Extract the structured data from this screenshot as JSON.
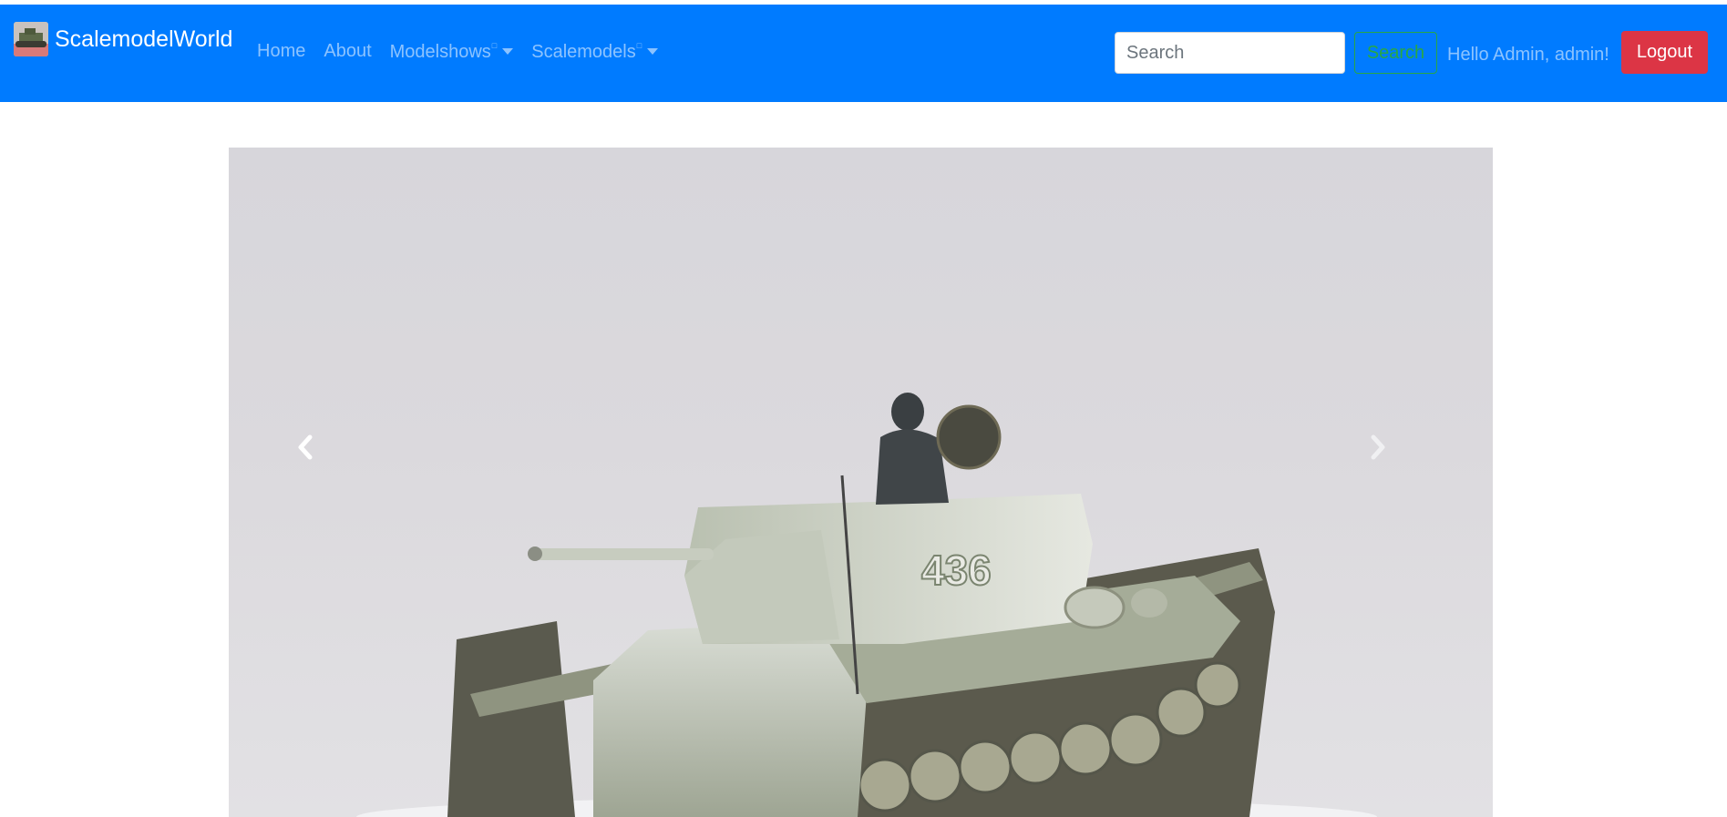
{
  "navbar": {
    "brand": "ScalemodelWorld",
    "links": [
      {
        "label": "Home"
      },
      {
        "label": "About"
      },
      {
        "label": "Modelshows",
        "marker": "□"
      },
      {
        "label": "Scalemodels",
        "marker": "□"
      }
    ],
    "search": {
      "placeholder": "Search",
      "button_label": "Search"
    },
    "greeting": "Hello Admin, admin!",
    "logout_label": "Logout"
  },
  "carousel": {
    "slide": {
      "tank_number": "436"
    },
    "prev_icon": "chevron-left-icon",
    "next_icon": "chevron-right-icon"
  },
  "colors": {
    "navbar_bg": "#007bff",
    "logout_bg": "#dc3545",
    "search_outline": "#28a745",
    "nav_link": "rgba(255,255,255,.55)"
  }
}
